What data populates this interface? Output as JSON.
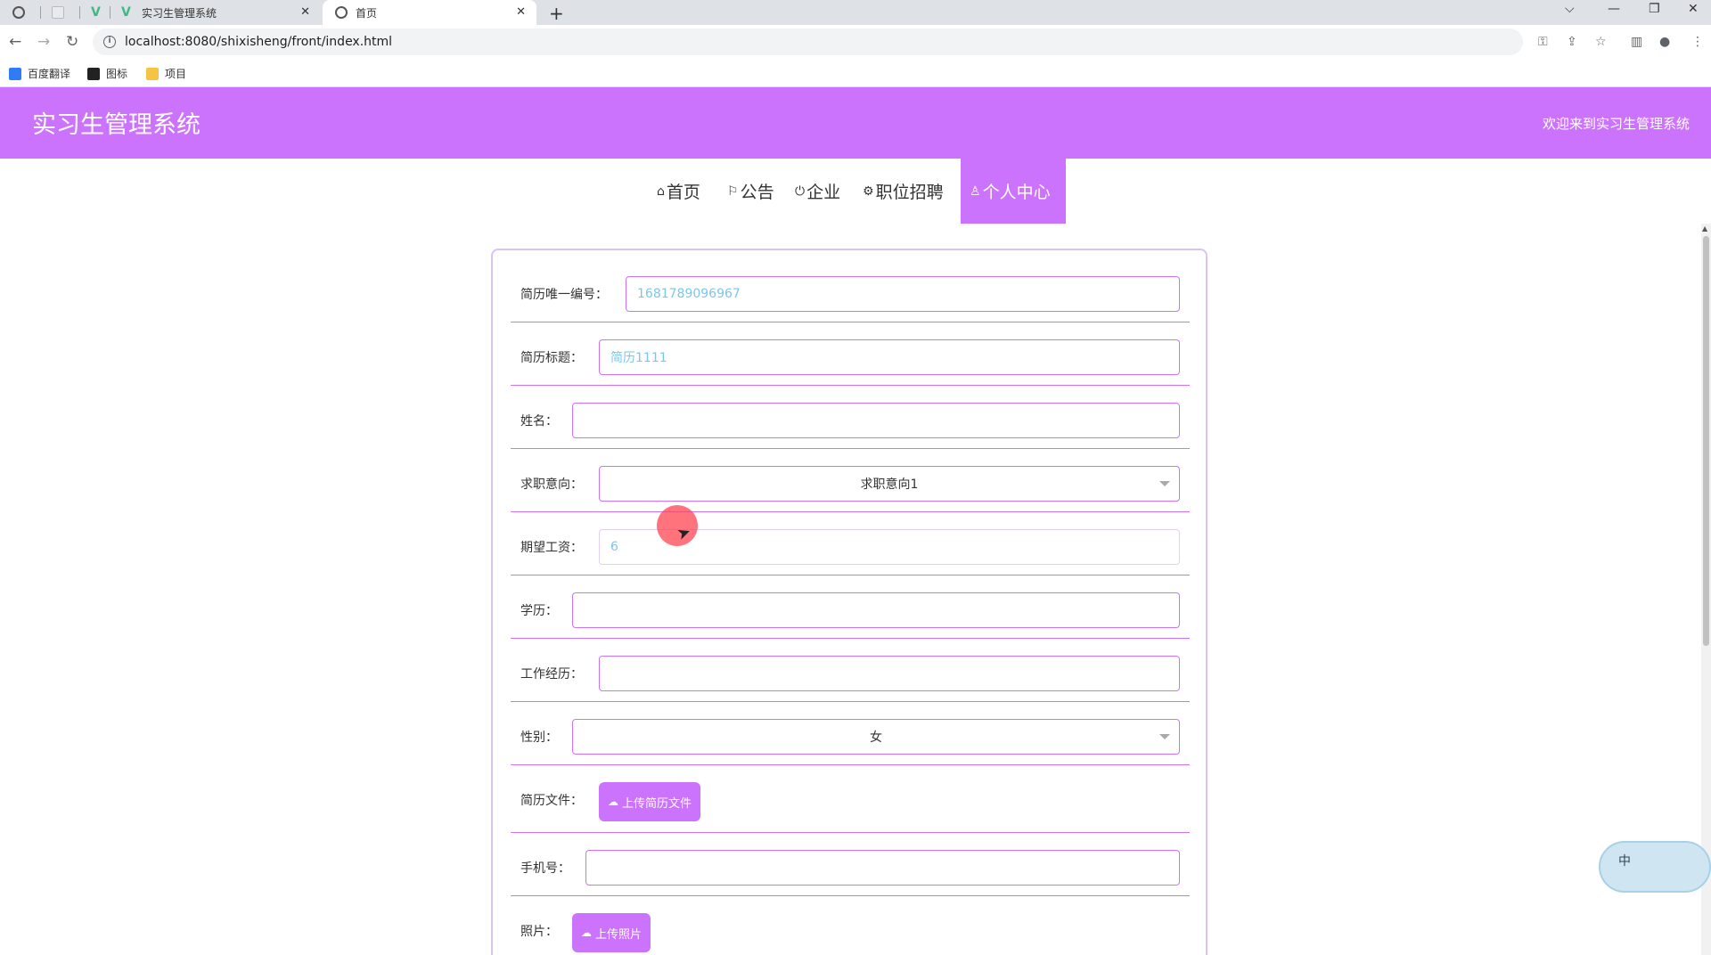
{
  "browser": {
    "tabs": [
      {
        "title": "",
        "active": false
      },
      {
        "title": "",
        "active": false
      },
      {
        "title": "",
        "active": false
      },
      {
        "title": "实习生管理系统",
        "active": false
      },
      {
        "title": "首页",
        "active": true
      }
    ],
    "url": "localhost:8080/shixisheng/front/index.html",
    "bookmarks": [
      "百度翻译",
      "图标",
      "项目"
    ]
  },
  "header": {
    "title": "实习生管理系统",
    "welcome": "欢迎来到实习生管理系统"
  },
  "nav": {
    "items": [
      {
        "label": "首页",
        "icon": "home-icon"
      },
      {
        "label": "公告",
        "icon": "flag-icon"
      },
      {
        "label": "企业",
        "icon": "power-icon"
      },
      {
        "label": "职位招聘",
        "icon": "gear-icon"
      },
      {
        "label": "个人中心",
        "icon": "user-icon",
        "active": true
      }
    ]
  },
  "form": {
    "resume_id": {
      "label": "简历唯一编号：",
      "value": "1681789096967"
    },
    "resume_title": {
      "label": "简历标题：",
      "value": "简历1111"
    },
    "name": {
      "label": "姓名：",
      "value": ""
    },
    "job_intent": {
      "label": "求职意向：",
      "value": "求职意向1"
    },
    "salary": {
      "label": "期望工资：",
      "value": "6"
    },
    "education": {
      "label": "学历：",
      "value": ""
    },
    "experience": {
      "label": "工作经历：",
      "value": ""
    },
    "gender": {
      "label": "性别：",
      "value": "女"
    },
    "resume_file": {
      "label": "简历文件：",
      "button": "上传简历文件"
    },
    "phone": {
      "label": "手机号：",
      "value": ""
    },
    "photo": {
      "label": "照片：",
      "button": "上传照片"
    }
  },
  "ime": {
    "label": "中"
  },
  "colors": {
    "accent": "#cc73fd",
    "readonly_text": "#7cc6e9"
  }
}
